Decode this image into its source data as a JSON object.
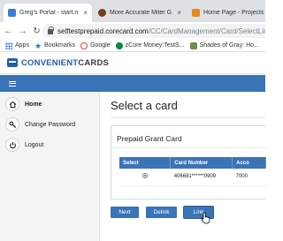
{
  "browser": {
    "tabs": [
      {
        "title": "Greg's Portal - start.me",
        "close": "×"
      },
      {
        "title": "More Accurate Miter Gauge",
        "close": "×"
      },
      {
        "title": "Home Page - Projects",
        "close": "×"
      }
    ],
    "nav": {
      "back": "←",
      "forward": "→",
      "reload": "↻"
    },
    "url": {
      "host": "selftestprepaid.corecard.com",
      "path": "/CC/CardManagement/Card/SelectLinke"
    },
    "bookmarks": [
      {
        "label": "Apps",
        "icon": "apps-icon"
      },
      {
        "label": "Bookmarks",
        "icon": "star-icon"
      },
      {
        "label": "Google",
        "icon": "google-icon"
      },
      {
        "label": "zCore Money:TestS...",
        "icon": "money-icon"
      },
      {
        "label": "Shades of Gray: Ho...",
        "icon": "gray-icon"
      }
    ]
  },
  "brand": {
    "part1": "CONVENIENT",
    "part2": "CARDS"
  },
  "sidebar": {
    "items": [
      {
        "label": "Home",
        "icon": "home-icon",
        "active": true
      },
      {
        "label": "Change Password",
        "icon": "key-icon",
        "active": false
      },
      {
        "label": "Logout",
        "icon": "power-icon",
        "active": false
      }
    ]
  },
  "main": {
    "title": "Select a card",
    "panel": {
      "title": "Prepaid Grant Card",
      "columns": [
        "Select",
        "Card Number",
        "Acco"
      ],
      "rows": [
        {
          "card_number": "406681******0909",
          "account": "7000"
        }
      ]
    },
    "buttons": {
      "next": "Next",
      "delink": "Delink",
      "link": "Link"
    }
  },
  "colors": {
    "accent": "#3a74b6",
    "brand_blue": "#1f5fa8",
    "sidebar_bg": "#f2f4f6"
  }
}
